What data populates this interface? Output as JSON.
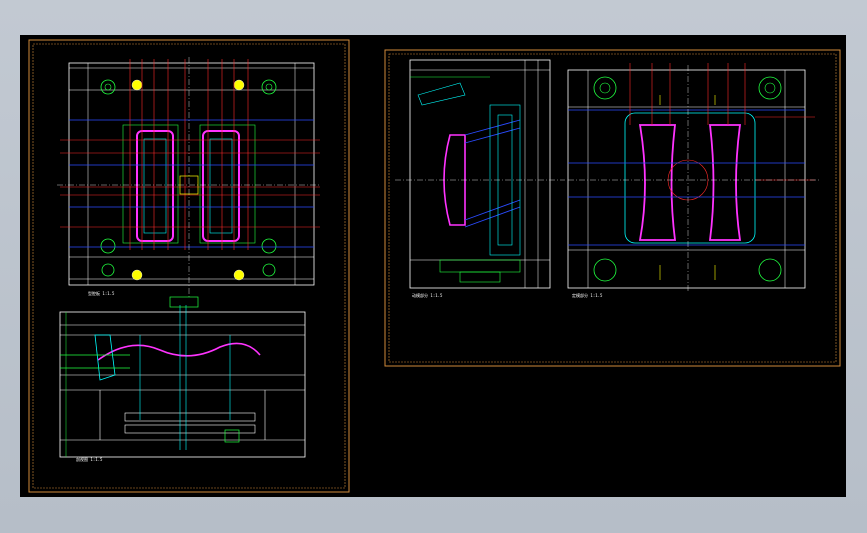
{
  "drawing_area": {
    "background": "#000000",
    "frame_color": "#d08a3a"
  },
  "sheet_left": {
    "plan_view_title": "型腔板 1:1.5",
    "section_view_title": "剖视图 1:1.5"
  },
  "sheet_right": {
    "front_view_title": "动模部分 1:1.5",
    "core_view_title": "定模部分 1:1.5"
  },
  "colors": {
    "white": "#ffffff",
    "red": "#ff2a2a",
    "green": "#20ff40",
    "yellow": "#ffff00",
    "cyan": "#00ffff",
    "magenta": "#ff33ff",
    "blue": "#2a4bff",
    "orange": "#d08a3a"
  }
}
